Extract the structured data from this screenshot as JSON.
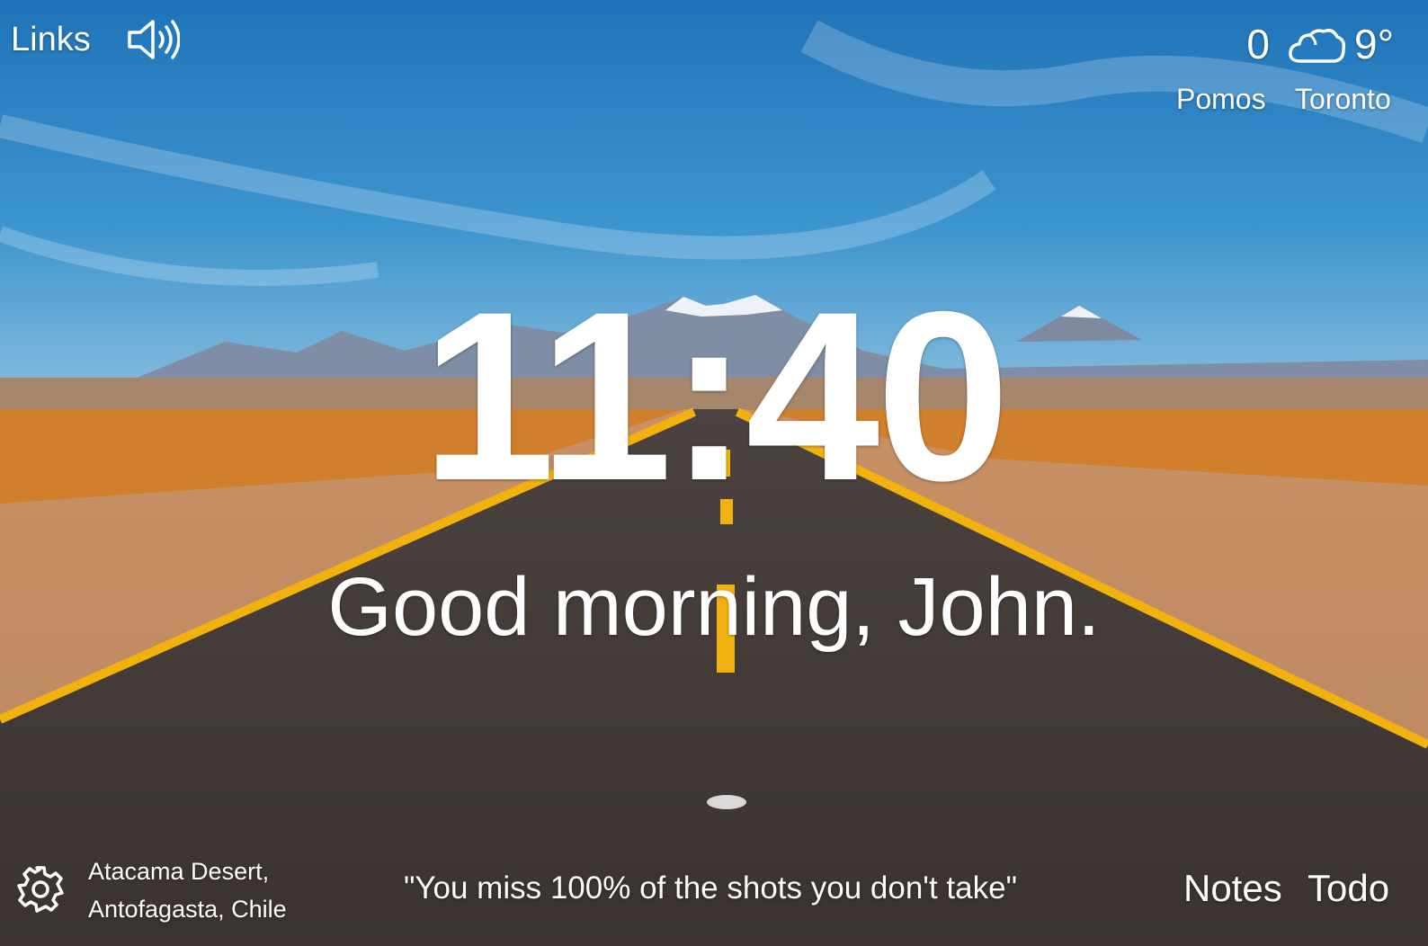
{
  "header": {
    "links_label": "Links",
    "sound_icon": "speaker-volume-icon"
  },
  "widgets": {
    "pomo_count": "0",
    "pomos_label": "Pomos",
    "weather_icon": "cloud-icon",
    "temperature": "9°",
    "city": "Toronto"
  },
  "main": {
    "time": "11:40",
    "greeting": "Good morning, John."
  },
  "footer": {
    "settings_icon": "gear-icon",
    "location_line1": "Atacama Desert,",
    "location_line2": "Antofagasta, Chile",
    "quote": "\"You miss 100% of the shots you don't take\"",
    "notes_label": "Notes",
    "todo_label": "Todo"
  },
  "colors": {
    "text": "#ffffff",
    "sky": "#2f86c4",
    "road_line": "#f2b10e",
    "asphalt": "#3c3532",
    "desert": "#c9774a"
  }
}
